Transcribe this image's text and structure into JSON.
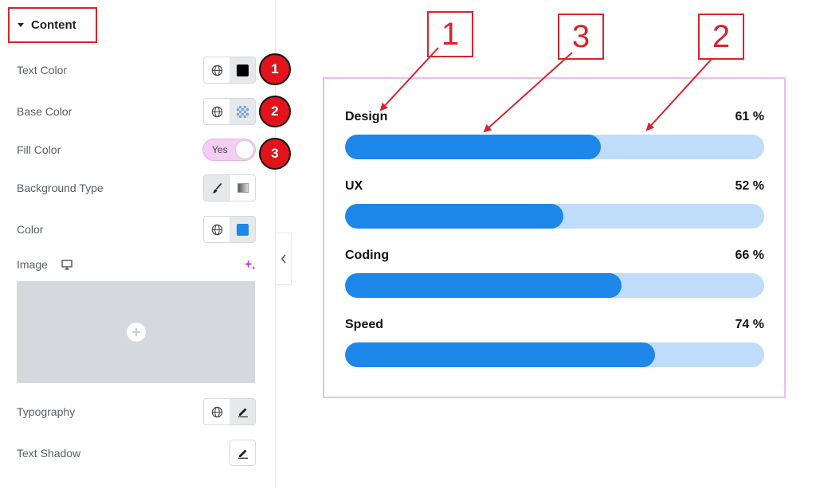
{
  "panel": {
    "section_title": "Content",
    "rows": {
      "text_color": "Text Color",
      "base_color": "Base Color",
      "fill_color": "Fill Color",
      "background_type": "Background Type",
      "color": "Color",
      "image": "Image",
      "typography": "Typography",
      "text_shadow": "Text Shadow"
    },
    "fill_toggle_label": "Yes",
    "badges": [
      "1",
      "2",
      "3"
    ],
    "colors": {
      "text_color_swatch": "#000000",
      "color_swatch": "#1d87ea",
      "badge": "#e1131b",
      "toggle_bg": "#f3cdf3"
    },
    "icons": [
      "caret-down-icon",
      "globe-icon",
      "brush-icon",
      "gradient-icon",
      "monitor-icon",
      "ai-sparkle-icon",
      "plus-icon",
      "pencil-icon",
      "chevron-left-icon"
    ]
  },
  "preview": {
    "bars": [
      {
        "label": "Design",
        "percent_text": "61 %",
        "percent": 61
      },
      {
        "label": "UX",
        "percent_text": "52 %",
        "percent": 52
      },
      {
        "label": "Coding",
        "percent_text": "66 %",
        "percent": 66
      },
      {
        "label": "Speed",
        "percent_text": "74 %",
        "percent": 74
      }
    ],
    "callouts": [
      "1",
      "3",
      "2"
    ],
    "colors": {
      "bar_fill": "#1d87ea",
      "bar_track": "#bfdcfa",
      "widget_border": "#edbdec",
      "callout_red": "#d9232d"
    }
  }
}
